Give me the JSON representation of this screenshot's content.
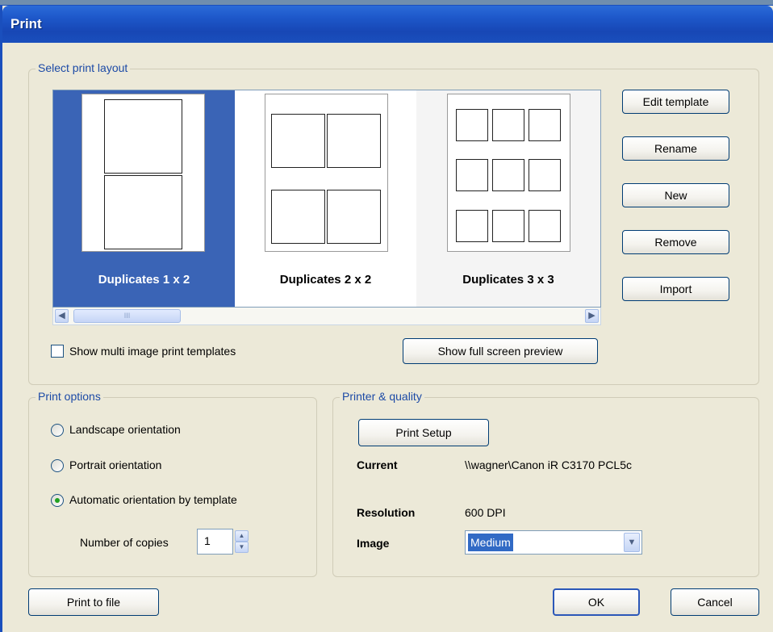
{
  "window": {
    "title": "Print"
  },
  "layout_group": {
    "label": "Select print layout",
    "templates": [
      {
        "caption": "Duplicates 1 x 2",
        "selected": true
      },
      {
        "caption": "Duplicates 2 x 2",
        "selected": false
      },
      {
        "caption": "Duplicates 3 x 3",
        "selected": false
      }
    ],
    "buttons": {
      "edit_template": "Edit template",
      "rename": "Rename",
      "new": "New",
      "remove": "Remove",
      "import": "Import"
    },
    "scrollbar": {
      "left_icon": "left-arrow-icon",
      "right_icon": "right-arrow-icon",
      "grip": "III"
    },
    "show_multi_label": "Show multi image print templates",
    "show_multi_checked": false,
    "preview_button": "Show full screen preview"
  },
  "print_options": {
    "label": "Print options",
    "landscape": "Landscape orientation",
    "portrait": "Portrait orientation",
    "automatic": "Automatic orientation by template",
    "selected": "automatic",
    "copies_label": "Number of copies",
    "copies_value": "1"
  },
  "printer_quality": {
    "label": "Printer & quality",
    "setup_button": "Print Setup",
    "current_label": "Current",
    "current_value": "\\\\wagner\\Canon iR C3170 PCL5c",
    "resolution_label": "Resolution",
    "resolution_value": "600 DPI",
    "image_label": "Image",
    "image_value": "Medium"
  },
  "footer": {
    "print_to_file": "Print to file",
    "ok": "OK",
    "cancel": "Cancel"
  },
  "colors": {
    "titlebar": "#1d56c8",
    "selection": "#3a64b6",
    "group_label": "#1c4aa6",
    "window_bg": "#ece9d8"
  }
}
